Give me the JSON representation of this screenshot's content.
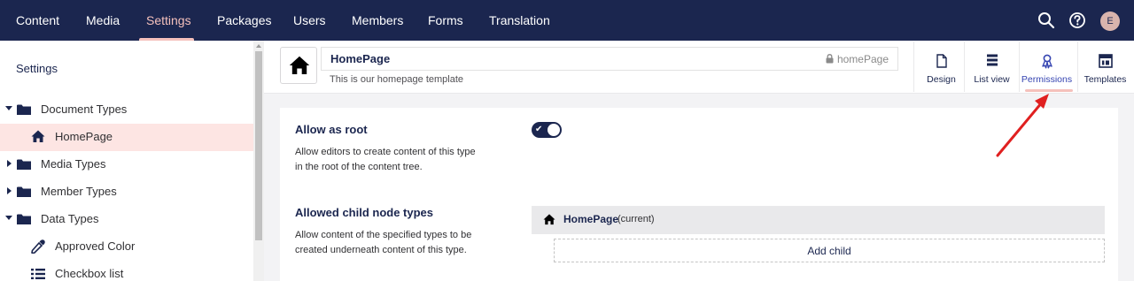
{
  "nav": {
    "items": [
      "Content",
      "Media",
      "Settings",
      "Packages",
      "Users",
      "Members",
      "Forms",
      "Translation"
    ],
    "active": "Settings",
    "avatar_initial": "E",
    "icons": [
      "search-icon",
      "help-icon"
    ]
  },
  "sidebar": {
    "title": "Settings",
    "items": [
      {
        "label": "Document Types",
        "icon": "folder-icon",
        "expanded": true
      },
      {
        "label": "HomePage",
        "icon": "home-icon",
        "selected": true
      },
      {
        "label": "Media Types",
        "icon": "folder-icon",
        "expanded": false
      },
      {
        "label": "Member Types",
        "icon": "folder-icon",
        "expanded": false
      },
      {
        "label": "Data Types",
        "icon": "folder-icon",
        "expanded": true
      },
      {
        "label": "Approved Color",
        "icon": "dropper-icon"
      },
      {
        "label": "Checkbox list",
        "icon": "list-icon"
      }
    ]
  },
  "header": {
    "name": "HomePage",
    "alias": "homePage",
    "description": "This is our homepage template",
    "apps": [
      "Design",
      "List view",
      "Permissions",
      "Templates"
    ],
    "active_app": "Permissions"
  },
  "permissions": {
    "allow_root": {
      "title": "Allow as root",
      "desc": "Allow editors to create content of this type in the root of the content tree.",
      "enabled": true
    },
    "child_types": {
      "title": "Allowed child node types",
      "desc": "Allow content of the specified types to be created underneath content of this type.",
      "items": [
        {
          "name": "HomePage",
          "suffix": "(current)"
        }
      ],
      "add_label": "Add child"
    }
  },
  "colors": {
    "navbar": "#1b264f",
    "accent": "#f5c1bc",
    "selected_bg": "#fde5e3",
    "annotation_arrow": "#e02020"
  }
}
